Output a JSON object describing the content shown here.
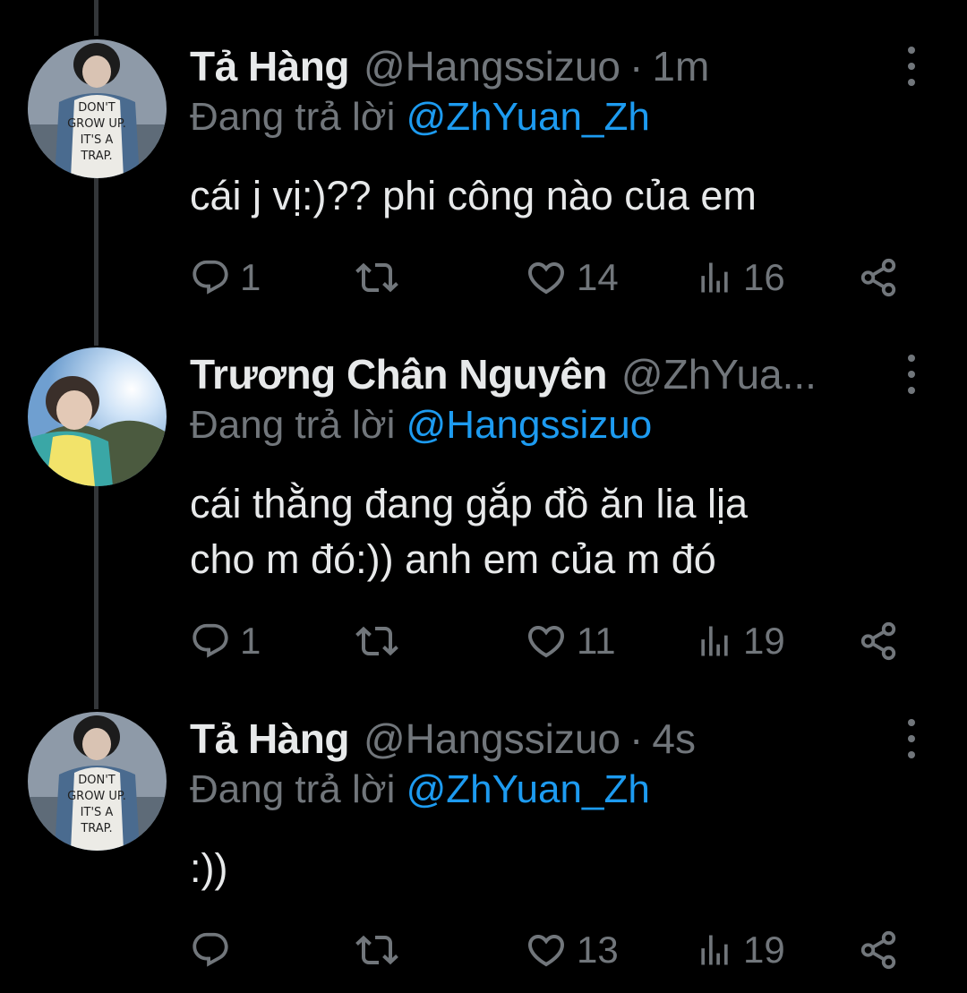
{
  "tweets": [
    {
      "name": "Tả Hàng",
      "handle": "@Hangssizuo",
      "separator": "·",
      "time": "1m",
      "reply_prefix": "Đang trả lời",
      "reply_to": "@ZhYuan_Zh",
      "text": "cái j vị:)?? phi công nào của em",
      "replies": "1",
      "retweets": "",
      "likes": "14",
      "views": "16"
    },
    {
      "name": "Trương Chân Nguyên",
      "handle": "@ZhYua...",
      "separator": "",
      "time": "",
      "reply_prefix": "Đang trả lời",
      "reply_to": "@Hangssizuo",
      "text": "cái thằng đang gắp đồ ăn lia lịa\ncho m đó:)) anh em của m đó",
      "replies": "1",
      "retweets": "",
      "likes": "11",
      "views": "19"
    },
    {
      "name": "Tả Hàng",
      "handle": "@Hangssizuo",
      "separator": "·",
      "time": "4s",
      "reply_prefix": "Đang trả lời",
      "reply_to": "@ZhYuan_Zh",
      "text": ":))",
      "replies": "",
      "retweets": "",
      "likes": "13",
      "views": "19"
    }
  ],
  "colors": {
    "background": "#000000",
    "primary_text": "#e7e9ea",
    "secondary_text": "#71767b",
    "accent": "#1d9bf0",
    "thread_line": "#333639"
  },
  "icons": [
    "reply-icon",
    "retweet-icon",
    "like-icon",
    "views-icon",
    "share-icon",
    "more-icon"
  ]
}
